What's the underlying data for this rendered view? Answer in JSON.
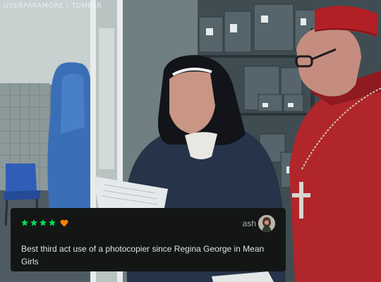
{
  "watermark": "USERPARAMORE | TUMBLR",
  "review": {
    "rating": 4,
    "liked": true,
    "username": "ash",
    "text": "Best third act use of a photocopier since Regina George in Mean Girls",
    "star_color": "#00e054",
    "heart_color": "#ff8000"
  }
}
